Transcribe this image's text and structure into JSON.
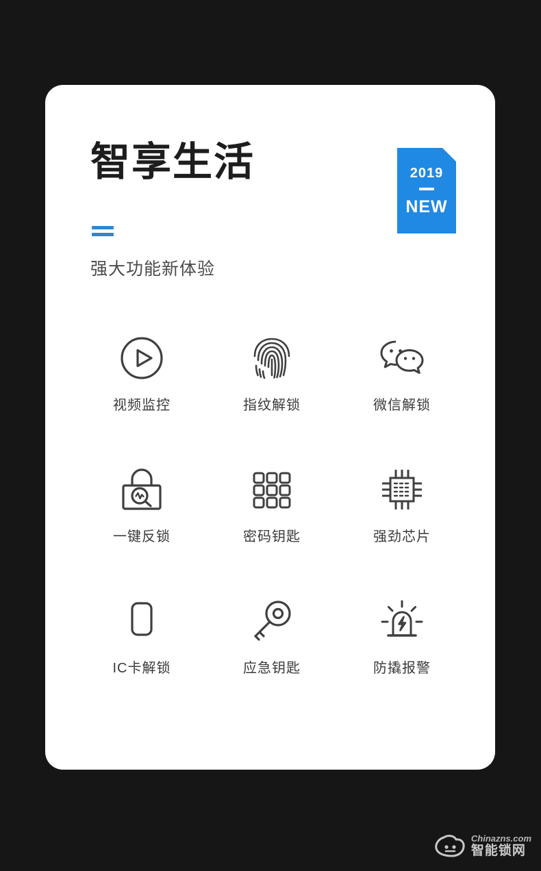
{
  "page": {
    "background_color": "#161616",
    "card_color": "#ffffff",
    "accent_color": "#2089e4",
    "divider_color": "#2e87cf",
    "icon_color": "#3f3f3f"
  },
  "header": {
    "title": "智享生活",
    "subtitle": "强大功能新体验",
    "divider_icon": "equals-bars-icon",
    "badge": {
      "year": "2019",
      "label": "NEW",
      "color": "#2089e4"
    }
  },
  "features": [
    {
      "icon": "video-play-circle-icon",
      "label": "视频监控"
    },
    {
      "icon": "fingerprint-icon",
      "label": "指纹解锁"
    },
    {
      "icon": "wechat-bubbles-icon",
      "label": "微信解锁"
    },
    {
      "icon": "padlock-search-icon",
      "label": "一键反锁"
    },
    {
      "icon": "keypad-grid-icon",
      "label": "密码钥匙"
    },
    {
      "icon": "cpu-chip-icon",
      "label": "强劲芯片"
    },
    {
      "icon": "ic-card-icon",
      "label": "IC卡解锁"
    },
    {
      "icon": "key-icon",
      "label": "应急钥匙"
    },
    {
      "icon": "alarm-siren-icon",
      "label": "防撬报警"
    }
  ],
  "watermark": {
    "logo_icon": "cloud-face-logo-icon",
    "url": "Chinazns.com",
    "name": "智能锁网"
  }
}
